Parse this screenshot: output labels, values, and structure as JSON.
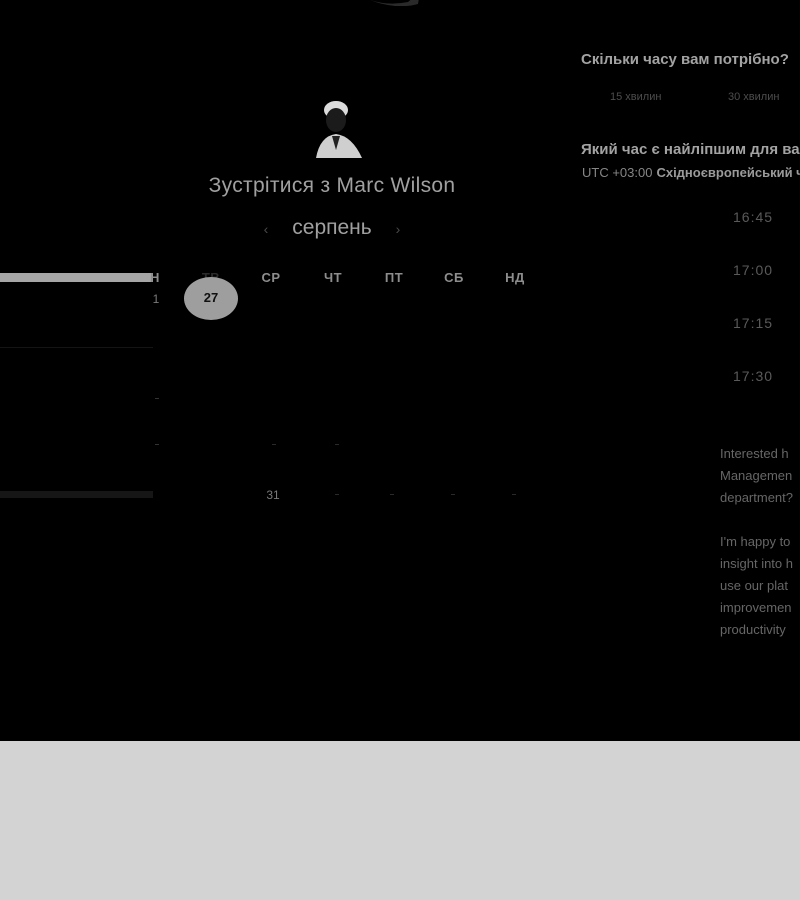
{
  "booking": {
    "title_prefix": "Зустрітися з",
    "host_name": "Marc Wilson",
    "month": "серпень",
    "weekdays": [
      "Н",
      "ТВ",
      "СР",
      "ЧТ",
      "ПТ",
      "СБ",
      "НД"
    ],
    "first_row_day": "1",
    "selected_day": "27",
    "last_row_day": "31"
  },
  "duration": {
    "question": "Скільки часу вам потрібно?",
    "options": [
      "15 хвилин",
      "30 хвилин"
    ]
  },
  "time": {
    "question": "Який час є найліпшим для вас?",
    "tz_offset": "UTC +03:00",
    "tz_name": "Східноєвропейський час",
    "slots": [
      "16:45",
      "17:00",
      "17:15",
      "17:30"
    ]
  },
  "description": {
    "para1": [
      "Interested h",
      "Managemen",
      "department?"
    ],
    "para2": [
      "I'm happy to",
      "insight into h",
      "use our plat",
      "improvemen",
      "productivity"
    ]
  },
  "colors": {
    "panel_bg": "#000000",
    "page_bg": "#d3d3d3",
    "selected_day_bg": "#9e9e9e"
  }
}
